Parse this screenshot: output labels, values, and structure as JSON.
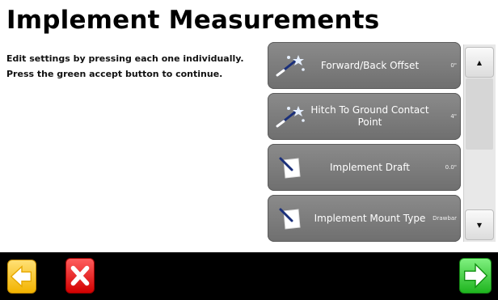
{
  "header": {
    "title": "Implement Measurements"
  },
  "instructions": {
    "line1": "Edit settings by pressing each one individually.",
    "line2": "Press the green accept button to continue."
  },
  "settings": [
    {
      "label": "Forward/Back Offset",
      "value": "0\"",
      "icon": "measurement-wand-icon"
    },
    {
      "label": "Hitch To Ground Contact Point",
      "value": "4\"",
      "icon": "measurement-wand-icon"
    },
    {
      "label": "Implement Draft",
      "value": "0.0\"",
      "icon": "draft-pen-icon"
    },
    {
      "label": "Implement Mount Type",
      "value": "Drawbar",
      "icon": "mount-pen-icon"
    }
  ],
  "footer": {
    "back_icon": "back-arrow-icon",
    "cancel_icon": "cancel-x-icon",
    "accept_icon": "accept-arrow-icon"
  },
  "colors": {
    "button_grey": "#7a7a7a",
    "back_yellow": "#f2b300",
    "cancel_red": "#d20000",
    "accept_green": "#1fb51f"
  }
}
